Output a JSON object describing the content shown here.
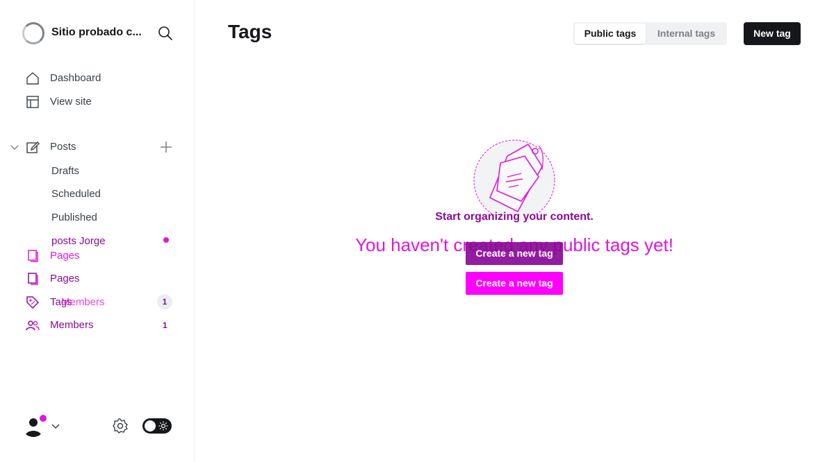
{
  "sidebar": {
    "site_title": "Sitio probado c...",
    "nav": {
      "dashboard": "Dashboard",
      "view_site": "View site",
      "posts": "Posts",
      "drafts": "Drafts",
      "scheduled": "Scheduled",
      "published": "Published",
      "posts_jorge": "posts Jorge",
      "pages_a": "Pages",
      "pages_b": "Pages",
      "tags": "Tags",
      "members_a": "Members",
      "members_b": "Members",
      "members_count_a": "1",
      "members_count_b": "1"
    }
  },
  "main": {
    "title": "Tags",
    "tabs": [
      {
        "label": "Public tags",
        "active": true
      },
      {
        "label": "Internal tags",
        "active": false
      }
    ],
    "new_tag_label": "New tag",
    "empty_title": "Start organizing your content.",
    "empty_desc": "You haven't created any public tags yet!",
    "create_label_1": "Create a new tag",
    "create_label_2": "Create a new tag"
  },
  "colors": {
    "accent_pink": "#e016e0",
    "accent_purple": "#8a0a96",
    "dark": "#15171a"
  }
}
